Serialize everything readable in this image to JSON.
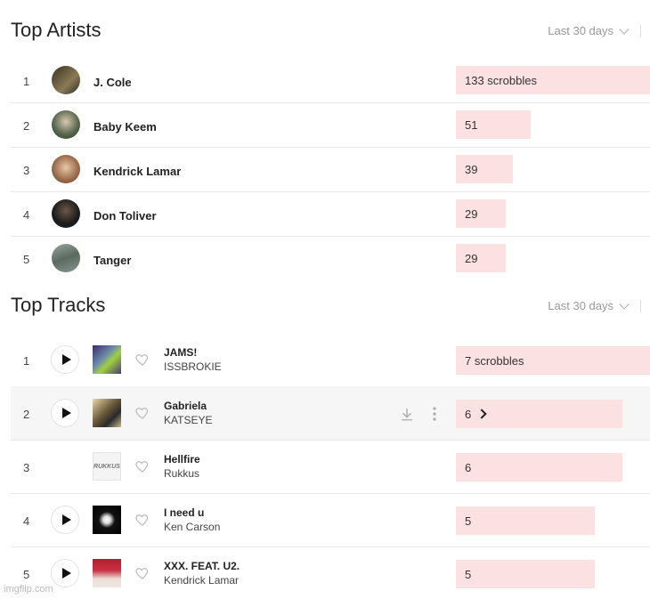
{
  "top_artists": {
    "title": "Top Artists",
    "range": "Last 30 days",
    "rows": [
      {
        "rank": "1",
        "name": "J. Cole",
        "count": "133 scrobbles",
        "value": 133
      },
      {
        "rank": "2",
        "name": "Baby Keem",
        "count": "51",
        "value": 51
      },
      {
        "rank": "3",
        "name": "Kendrick Lamar",
        "count": "39",
        "value": 39
      },
      {
        "rank": "4",
        "name": "Don Toliver",
        "count": "29",
        "value": 29
      },
      {
        "rank": "5",
        "name": "Tanger",
        "count": "29",
        "value": 29
      }
    ]
  },
  "top_tracks": {
    "title": "Top Tracks",
    "range": "Last 30 days",
    "rows": [
      {
        "rank": "1",
        "name": "JAMS!",
        "artist": "ISSBROKIE",
        "count": "7 scrobbles",
        "value": 7
      },
      {
        "rank": "2",
        "name": "Gabriela",
        "artist": "KATSEYE",
        "count": "6",
        "value": 6
      },
      {
        "rank": "3",
        "name": "Hellfire",
        "artist": "Rukkus",
        "count": "6",
        "value": 6
      },
      {
        "rank": "4",
        "name": "I need u",
        "artist": "Ken Carson",
        "count": "5",
        "value": 5
      },
      {
        "rank": "5",
        "name": "XXX. FEAT. U2.",
        "artist": "Kendrick Lamar",
        "count": "5",
        "value": 5
      }
    ]
  },
  "watermark": "imgflip.com",
  "colors": {
    "bar": "#fbe1e1",
    "text": "#222222",
    "muted": "#999999"
  },
  "icons": [
    "play-icon",
    "heart-icon",
    "download-icon",
    "more-icon",
    "chevron-down-icon",
    "chevron-right-icon"
  ]
}
